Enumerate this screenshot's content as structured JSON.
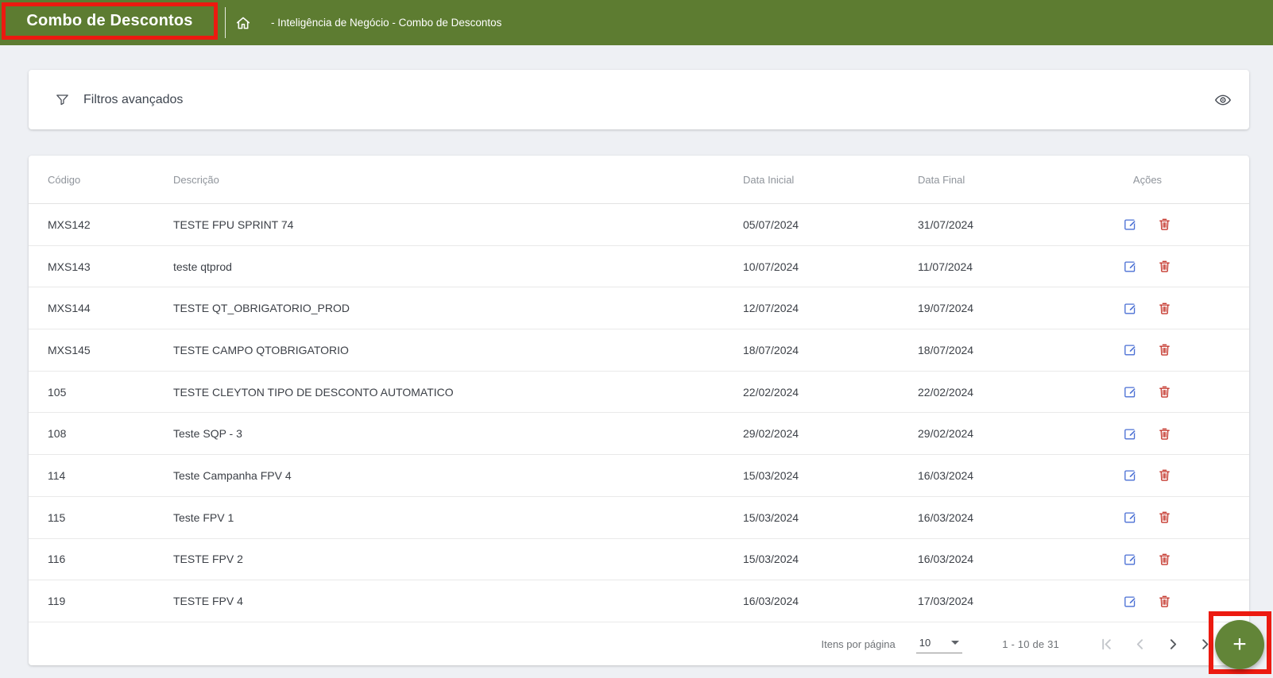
{
  "header": {
    "title": "Combo de Descontos",
    "breadcrumb": "- Inteligência de Negócio - Combo de Descontos"
  },
  "filters": {
    "label": "Filtros avançados"
  },
  "table": {
    "columns": [
      "Código",
      "Descrição",
      "Data Inicial",
      "Data Final",
      "Ações"
    ],
    "rows": [
      {
        "codigo": "MXS142",
        "descricao": "TESTE FPU SPRINT 74",
        "data_inicial": "05/07/2024",
        "data_final": "31/07/2024"
      },
      {
        "codigo": "MXS143",
        "descricao": "teste qtprod",
        "data_inicial": "10/07/2024",
        "data_final": "11/07/2024"
      },
      {
        "codigo": "MXS144",
        "descricao": "TESTE QT_OBRIGATORIO_PROD",
        "data_inicial": "12/07/2024",
        "data_final": "19/07/2024"
      },
      {
        "codigo": "MXS145",
        "descricao": "TESTE CAMPO QTOBRIGATORIO",
        "data_inicial": "18/07/2024",
        "data_final": "18/07/2024"
      },
      {
        "codigo": "105",
        "descricao": "TESTE CLEYTON TIPO DE DESCONTO AUTOMATICO",
        "data_inicial": "22/02/2024",
        "data_final": "22/02/2024"
      },
      {
        "codigo": "108",
        "descricao": "Teste SQP - 3",
        "data_inicial": "29/02/2024",
        "data_final": "29/02/2024"
      },
      {
        "codigo": "114",
        "descricao": "Teste Campanha FPV 4",
        "data_inicial": "15/03/2024",
        "data_final": "16/03/2024"
      },
      {
        "codigo": "115",
        "descricao": "Teste FPV 1",
        "data_inicial": "15/03/2024",
        "data_final": "16/03/2024"
      },
      {
        "codigo": "116",
        "descricao": "TESTE FPV 2",
        "data_inicial": "15/03/2024",
        "data_final": "16/03/2024"
      },
      {
        "codigo": "119",
        "descricao": "TESTE FPV 4",
        "data_inicial": "16/03/2024",
        "data_final": "17/03/2024"
      }
    ]
  },
  "pagination": {
    "items_per_page_label": "Itens por página",
    "items_per_page_value": "10",
    "range_label": "1 - 10 de 31"
  },
  "fab": {
    "label": "+"
  },
  "icons": {
    "breadcrumb_home": "home-icon",
    "filters": "funnel-icon",
    "filters_visibility": "eye-icon",
    "row_edit": "edit-icon",
    "row_delete": "trash-icon",
    "select_caret": "chevron-down-icon",
    "page_first": "first-page-icon",
    "page_previous": "chevron-left-icon",
    "page_next": "chevron-right-icon",
    "page_last": "last-page-icon",
    "add": "plus-icon"
  },
  "colors": {
    "header_green": "#5d7c31",
    "fab_green": "#628538",
    "annotation_red": "#ec1a10",
    "edit_blue": "#4a6fd4",
    "delete_red": "#c5392f",
    "page_background": "#eef0f4"
  }
}
